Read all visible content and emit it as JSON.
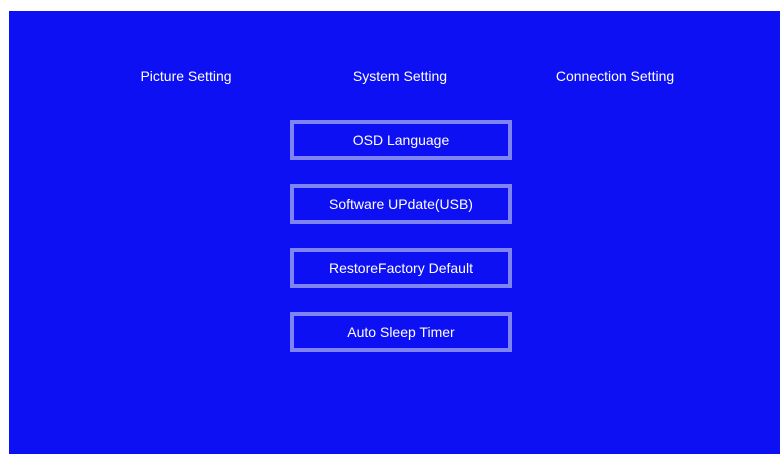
{
  "tabs": [
    {
      "label": "Picture Setting"
    },
    {
      "label": "System Setting"
    },
    {
      "label": "Connection Setting"
    }
  ],
  "menu": {
    "items": [
      {
        "label": "OSD Language"
      },
      {
        "label": "Software UPdate(USB)"
      },
      {
        "label": "RestoreFactory Default"
      },
      {
        "label": "Auto Sleep Timer"
      }
    ]
  },
  "colors": {
    "background": "#0c10f2",
    "item_border": "#7e83f6",
    "text": "#ffffff"
  }
}
